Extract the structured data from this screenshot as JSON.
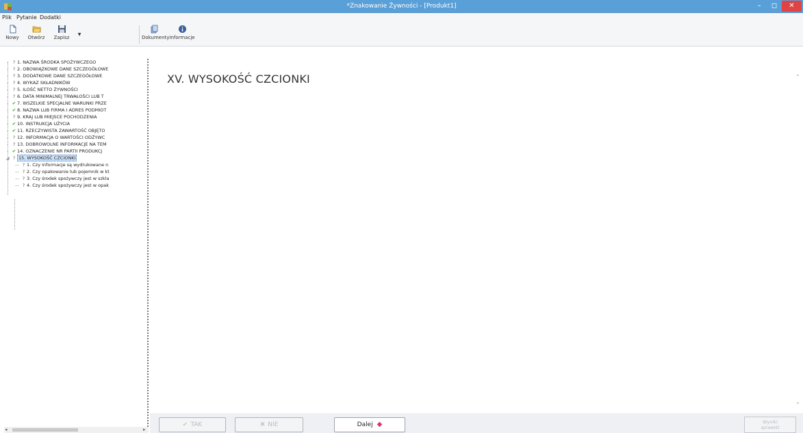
{
  "window": {
    "title": "*Znakowanie Żywności - [Produkt1]",
    "min_glyph": "–",
    "max_glyph": "◻",
    "close_glyph": "✕"
  },
  "menu": [
    "Plik",
    "Pytanie",
    "Dodatki"
  ],
  "toolbar": {
    "nowy": "Nowy",
    "otworz": "Otwórz",
    "zapisz": "Zapisz",
    "dropdown": "▼",
    "dokumenty": "Dokumenty",
    "informacje": "Informacje"
  },
  "tree": [
    {
      "mark": "?",
      "text": "1. NAZWA ŚRODKA SPOŻYWCZEGO",
      "state": "q"
    },
    {
      "mark": "?",
      "text": "2. OBOWIĄZKOWE DANE SZCZEGÓŁOWE",
      "state": "q"
    },
    {
      "mark": "?",
      "text": "3. DODATKOWE DANE SZCZEGÓŁOWE",
      "state": "q"
    },
    {
      "mark": "?",
      "text": "4. WYKAZ SKŁADNIKÓW",
      "state": "q"
    },
    {
      "mark": "?",
      "text": "5. ILOŚĆ NETTO ŻYWNOŚCI",
      "state": "q"
    },
    {
      "mark": "?",
      "text": "6. DATA MINIMALNEJ TRWAŁOŚCI LUB T",
      "state": "q"
    },
    {
      "mark": "✔",
      "text": "7. WSZELKIE SPECJALNE WARUNKI PRZE",
      "state": "ok"
    },
    {
      "mark": "✔",
      "text": "8. NAZWA LUB FIRMA I ADRES PODMIOT",
      "state": "ok"
    },
    {
      "mark": "?",
      "text": "9. KRAJ LUB MIEJSCE POCHODZENIA",
      "state": "q"
    },
    {
      "mark": "✔",
      "text": "10. INSTRUKCJA UŻYCIA",
      "state": "ok"
    },
    {
      "mark": "✔",
      "text": "11. RZECZYWISTA ZAWARTOŚĆ OBJĘTO",
      "state": "ok"
    },
    {
      "mark": "?",
      "text": "12. INFORMACJA O WARTOŚCI ODŻYWC",
      "state": "q"
    },
    {
      "mark": "?",
      "text": "13. DOBROWOLNE INFORMACJE NA TEM",
      "state": "q"
    },
    {
      "mark": "✔",
      "text": "14. OZNACZENIE NR PARTII PRODUKCJ",
      "state": "ok"
    },
    {
      "mark": "?",
      "text": "15. WYSOKOŚĆ CZCIONKI",
      "state": "selected"
    }
  ],
  "subtree": [
    {
      "mark": "?",
      "text": "1. Czy informacje są wydrukowane n"
    },
    {
      "mark": "?",
      "text": "2. Czy opakowanie lub pojemnik w kt"
    },
    {
      "mark": "?",
      "text": "3. Czy środek spożywczy jest w szkla"
    },
    {
      "mark": "?",
      "text": "4. Czy środek spożywczy jest w opak"
    }
  ],
  "content": {
    "section_title": "XV. WYSOKOŚĆ CZCIONKI"
  },
  "buttons": {
    "tak": "TAK",
    "nie": "NIE",
    "dalej": "Dalej",
    "wyniki": "Wyniki\nsprawdź"
  }
}
